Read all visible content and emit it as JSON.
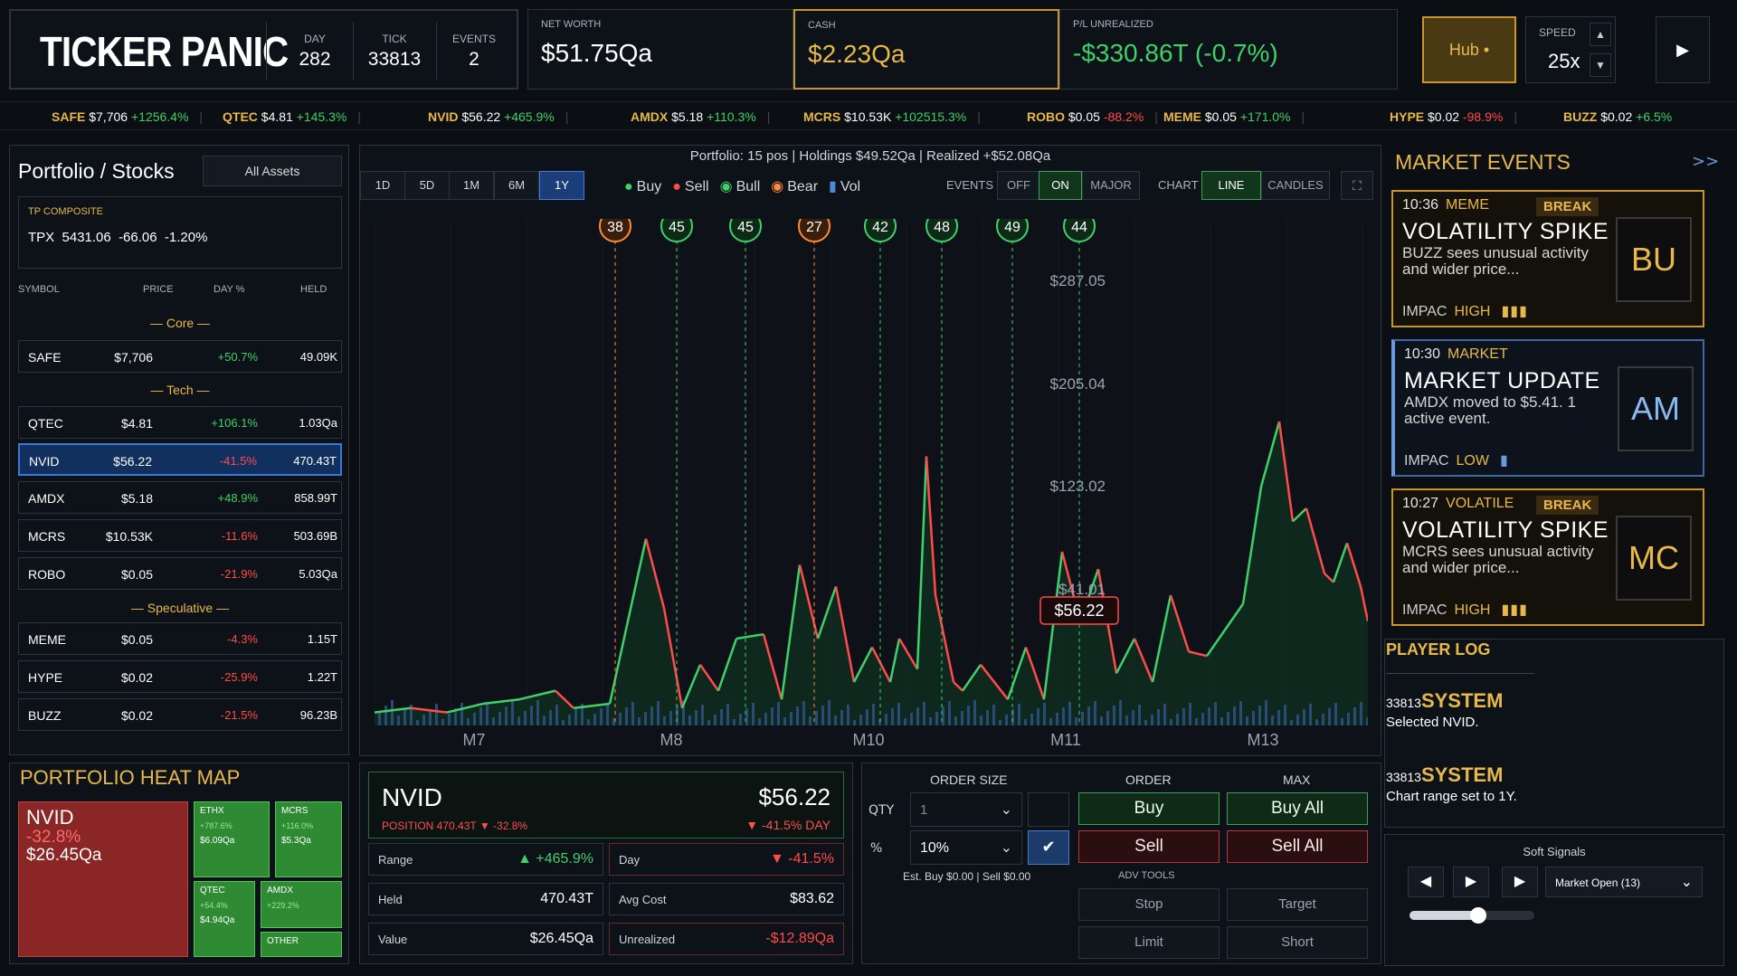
{
  "header": {
    "logo": "TICKER PANIC",
    "day_label": "DAY",
    "day": "282",
    "tick_label": "TICK",
    "tick": "33813",
    "events_label": "EVENTS",
    "events": "2"
  },
  "metrics": {
    "net_worth_label": "NET WORTH",
    "net_worth": "$51.75Qa",
    "cash_label": "CASH",
    "cash": "$2.23Qa",
    "pl_label": "P/L UNREALIZED",
    "pl": "-$330.86T (-0.7%)"
  },
  "controls": {
    "hub": "Hub •",
    "speed_label": "SPEED",
    "speed": "25x",
    "up": "▲",
    "down": "▼",
    "play": "▶"
  },
  "ticker": [
    {
      "sym": "SAFE",
      "price": "$7,706",
      "chg": "+1256.4%",
      "up": true
    },
    {
      "sym": "QTEC",
      "price": "$4.81",
      "chg": "+145.3%",
      "up": true
    },
    {
      "sym": "NVID",
      "price": "$56.22",
      "chg": "+465.9%",
      "up": true
    },
    {
      "sym": "AMDX",
      "price": "$5.18",
      "chg": "+110.3%",
      "up": true
    },
    {
      "sym": "MCRS",
      "price": "$10.53K",
      "chg": "+102515.3%",
      "up": true
    },
    {
      "sym": "ROBO",
      "price": "$0.05",
      "chg": "-88.2%",
      "up": false
    },
    {
      "sym": "MEME",
      "price": "$0.05",
      "chg": "+171.0%",
      "up": true
    },
    {
      "sym": "HYPE",
      "price": "$0.02",
      "chg": "-98.9%",
      "up": false
    },
    {
      "sym": "BUZZ",
      "price": "$0.02",
      "chg": "+6.5%",
      "up": true
    }
  ],
  "portfolio": {
    "title": "Portfolio / Stocks",
    "filter": "All Assets",
    "composite_label": "TP COMPOSITE",
    "composite": "TPX  5431.06  -66.06  -1.20%",
    "cols": [
      "SYMBOL",
      "PRICE",
      "DAY %",
      "HELD"
    ],
    "groups": {
      "core": "— Core —",
      "tech": "— Tech —",
      "spec": "— Speculative —"
    },
    "rows": [
      {
        "sym": "SAFE",
        "price": "$7,706",
        "day": "+50.7%",
        "held": "49.09K",
        "up": true
      },
      {
        "sym": "QTEC",
        "price": "$4.81",
        "day": "+106.1%",
        "held": "1.03Qa",
        "up": true
      },
      {
        "sym": "NVID",
        "price": "$56.22",
        "day": "-41.5%",
        "held": "470.43T",
        "up": false
      },
      {
        "sym": "AMDX",
        "price": "$5.18",
        "day": "+48.9%",
        "held": "858.99T",
        "up": true
      },
      {
        "sym": "MCRS",
        "price": "$10.53K",
        "day": "-11.6%",
        "held": "503.69B",
        "up": false
      },
      {
        "sym": "ROBO",
        "price": "$0.05",
        "day": "-21.9%",
        "held": "5.03Qa",
        "up": false
      },
      {
        "sym": "MEME",
        "price": "$0.05",
        "day": "-4.3%",
        "held": "1.15T",
        "up": false
      },
      {
        "sym": "HYPE",
        "price": "$0.02",
        "day": "-25.9%",
        "held": "1.22T",
        "up": false
      },
      {
        "sym": "BUZZ",
        "price": "$0.02",
        "day": "-21.5%",
        "held": "96.23B",
        "up": false
      }
    ]
  },
  "chart": {
    "summary": "Portfolio: 15 pos | Holdings $49.52Qa | Realized +$52.08Qa",
    "ranges": [
      "1D",
      "5D",
      "1M",
      "6M",
      "1Y"
    ],
    "active_range": "1Y",
    "legend": [
      "Buy",
      "Sell",
      "Bull",
      "Bear",
      "Vol"
    ],
    "events_label": "EVENTS",
    "events_opts": [
      "OFF",
      "ON",
      "MAJOR"
    ],
    "chart_label": "CHART",
    "chart_opts": [
      "LINE",
      "CANDLES"
    ],
    "expand": "⛶",
    "markers": [
      "38",
      "45",
      "45",
      "27",
      "42",
      "48",
      "49",
      "44"
    ],
    "price_labels": [
      "$287.05",
      "$205.04",
      "$123.02",
      "$41.01"
    ],
    "current": "$56.22",
    "xticks": [
      "M7",
      "M8",
      "M10",
      "M11",
      "M13"
    ]
  },
  "chart_data": {
    "type": "line",
    "x": [
      "M7",
      "M8",
      "M10",
      "M11",
      "M13"
    ],
    "ylim": [
      41.01,
      287.05
    ]
  },
  "heatmap": {
    "title": "PORTFOLIO HEAT MAP",
    "main": {
      "sym": "NVID",
      "chg": "-32.8%",
      "val": "$26.45Qa"
    },
    "tiles": [
      {
        "sym": "ETHX",
        "chg": "+787.6%",
        "val": "$6.09Qa"
      },
      {
        "sym": "MCRS",
        "chg": "+116.0%",
        "val": "$5.3Qa"
      },
      {
        "sym": "QTEC",
        "chg": "+54.4%",
        "val": "$4.94Qa"
      },
      {
        "sym": "AMDX",
        "chg": "+229.2%",
        "val": ""
      },
      {
        "sym": "OTHER",
        "chg": "",
        "val": ""
      }
    ]
  },
  "detail": {
    "sym": "NVID",
    "price": "$56.22",
    "position": "POSITION 470.43T ▼ -32.8%",
    "day": "▼ -41.5% DAY",
    "range_label": "Range",
    "range": "▲ +465.9%",
    "day_label": "Day",
    "day_val": "▼ -41.5%",
    "held_label": "Held",
    "held": "470.43T",
    "avg_label": "Avg Cost",
    "avg": "$83.62",
    "value_label": "Value",
    "value": "$26.45Qa",
    "unreal_label": "Unrealized",
    "unreal": "-$12.89Qa"
  },
  "order": {
    "size_label": "ORDER SIZE",
    "order_label": "ORDER",
    "max_label": "MAX",
    "qty_label": "QTY",
    "qty": "1",
    "pct_label": "%",
    "pct": "10%",
    "buy": "Buy",
    "sell": "Sell",
    "buy_all": "Buy All",
    "sell_all": "Sell All",
    "est": "Est. Buy $0.00 | Sell $0.00",
    "adv": "ADV TOOLS",
    "stop": "Stop",
    "target": "Target",
    "limit": "Limit",
    "short": "Short",
    "check": "✔"
  },
  "events": {
    "title": "MARKET EVENTS",
    "more": ">>",
    "items": [
      {
        "time": "10:36",
        "cat": "MEME",
        "tag": "BREAK",
        "title": "VOLATILITY SPIKE",
        "desc": "BUZZ sees unusual activity and wider price...",
        "imp": "IMPAC",
        "level": "HIGH",
        "bars": "▮▮▮",
        "badge": "BU"
      },
      {
        "time": "10:30",
        "cat": "MARKET",
        "tag": "",
        "title": "MARKET UPDATE",
        "desc": "AMDX moved to $5.41. 1 active event.",
        "imp": "IMPAC",
        "level": "LOW",
        "bars": "▮",
        "badge": "AM"
      },
      {
        "time": "10:27",
        "cat": "VOLATILE",
        "tag": "BREAK",
        "title": "VOLATILITY SPIKE",
        "desc": "MCRS sees unusual activity and wider price...",
        "imp": "IMPAC",
        "level": "HIGH",
        "bars": "▮▮▮",
        "badge": "MC"
      }
    ]
  },
  "log": {
    "title": "PLAYER LOG",
    "entries": [
      {
        "tick": "33813",
        "who": "SYSTEM",
        "msg": "Selected NVID."
      },
      {
        "tick": "33813",
        "who": "SYSTEM",
        "msg": "Chart range set to 1Y."
      }
    ]
  },
  "signals": {
    "title": "Soft Signals",
    "prev": "◀",
    "play": "▶",
    "next": "▶",
    "select": "Market Open (13)",
    "slider": 0.55
  }
}
